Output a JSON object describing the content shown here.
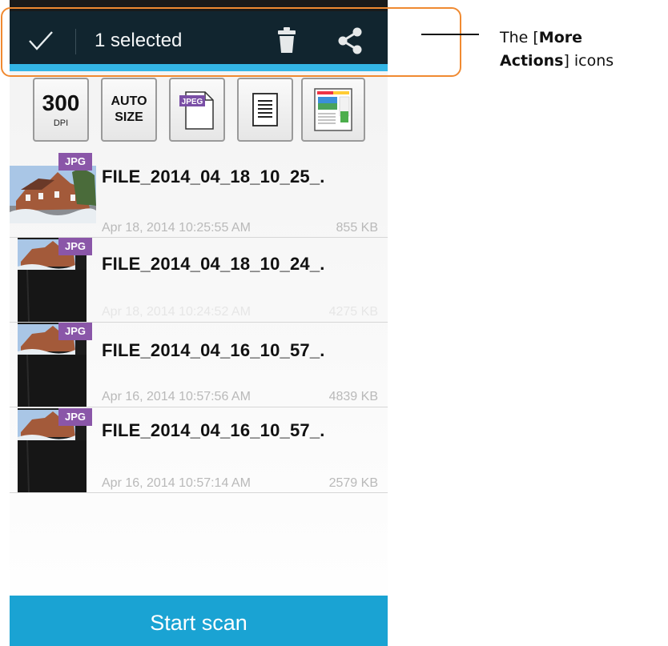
{
  "action_bar": {
    "selected_label": "1 selected"
  },
  "toolbar": {
    "dpi_value": "300",
    "dpi_unit": "DPI",
    "auto_line1": "AUTO",
    "auto_line2": "SIZE",
    "jpeg_badge": "JPEG"
  },
  "files": [
    {
      "badge": "JPG",
      "name": "FILE_2014_04_18_10_25_.",
      "date": "Apr 18, 2014 10:25:55 AM",
      "size": "855 KB"
    },
    {
      "badge": "JPG",
      "name": "FILE_2014_04_18_10_24_.",
      "date": "Apr 18, 2014 10:24:52 AM",
      "size": "4275 KB"
    },
    {
      "badge": "JPG",
      "name": "FILE_2014_04_16_10_57_.",
      "date": "Apr 16, 2014 10:57:56 AM",
      "size": "4839 KB"
    },
    {
      "badge": "JPG",
      "name": "FILE_2014_04_16_10_57_.",
      "date": "Apr 16, 2014 10:57:14 AM",
      "size": "2579 KB"
    }
  ],
  "start_scan_label": "Start scan",
  "callout": {
    "prefix": "The [",
    "bold_word1": "More",
    "bold_word2": "Actions",
    "suffix": "] icons"
  },
  "colors": {
    "action_bar_bg": "#11252f",
    "accent_blue": "#33b5e5",
    "scan_button": "#1aa3d3",
    "badge_purple": "#8a56a8",
    "highlight_orange": "#f08a31"
  }
}
